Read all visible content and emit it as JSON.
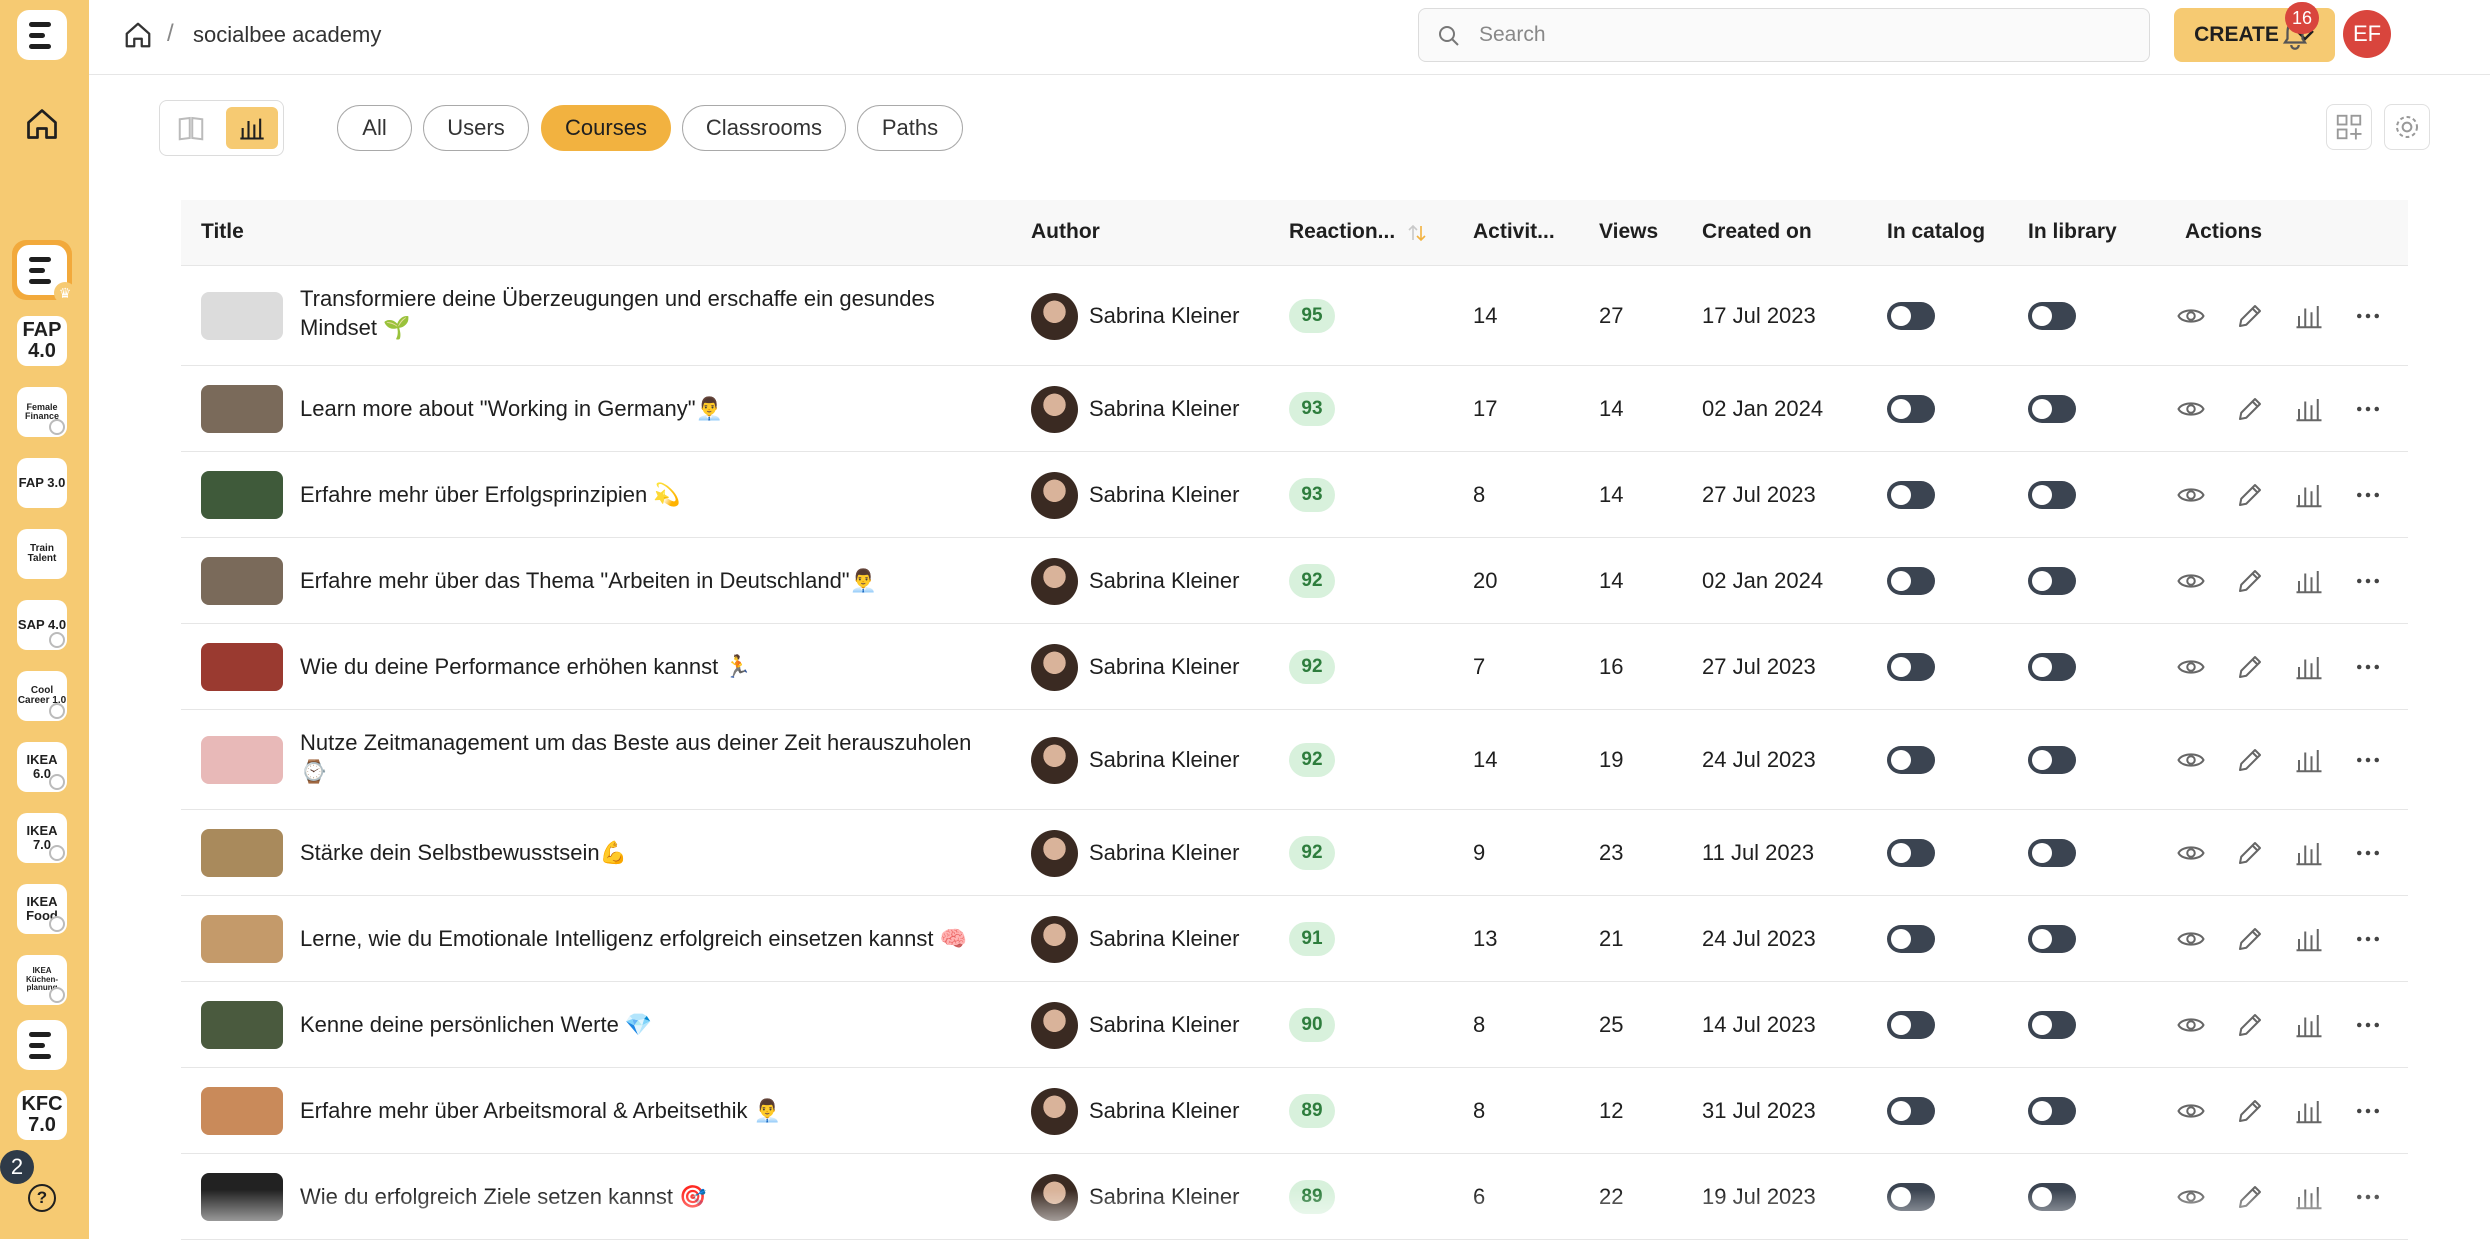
{
  "sidebar": {
    "tiles": [
      {
        "label": "FAP 4.0",
        "lock": false
      },
      {
        "label": "Female Finance",
        "lock": true
      },
      {
        "label": "FAP 3.0",
        "lock": false
      },
      {
        "label": "Train Talent",
        "lock": false
      },
      {
        "label": "SAP 4.0",
        "lock": true
      },
      {
        "label": "Cool Career 1.0",
        "lock": true
      },
      {
        "label": "IKEA 6.0",
        "lock": true
      },
      {
        "label": "IKEA 7.0",
        "lock": true
      },
      {
        "label": "IKEA Food",
        "lock": true
      },
      {
        "label": "IKEA Küchen-planung",
        "lock": true
      },
      {
        "label": "KFC 7.0",
        "lock": false
      }
    ],
    "count": "2",
    "help": "?"
  },
  "topbar": {
    "crumb_sep": "/",
    "breadcrumb": "socialbee academy",
    "search_placeholder": "Search",
    "create_label": "CREATE",
    "notifications": "16",
    "user_initials": "EF"
  },
  "filters": [
    "All",
    "Users",
    "Courses",
    "Classrooms",
    "Paths"
  ],
  "active_filter": "Courses",
  "table": {
    "headers": {
      "title": "Title",
      "author": "Author",
      "reactions": "Reaction...",
      "activity": "Activit...",
      "views": "Views",
      "created": "Created on",
      "catalog": "In catalog",
      "library": "In library",
      "actions": "Actions"
    },
    "rows": [
      {
        "title": "Transformiere deine Überzeugungen und erschaffe ein gesundes Mindset 🌱",
        "author": "Sabrina Kleiner",
        "reactions": "95",
        "activity": "14",
        "views": "27",
        "created": "17 Jul 2023",
        "thumb": "#dcdcdc"
      },
      {
        "title": "Learn more about \"Working in Germany\"👨‍💼",
        "author": "Sabrina Kleiner",
        "reactions": "93",
        "activity": "17",
        "views": "14",
        "created": "02 Jan 2024",
        "thumb": "#7a6a5a"
      },
      {
        "title": "Erfahre mehr über Erfolgsprinzipien 💫",
        "author": "Sabrina Kleiner",
        "reactions": "93",
        "activity": "8",
        "views": "14",
        "created": "27 Jul 2023",
        "thumb": "#3f5a3a"
      },
      {
        "title": "Erfahre mehr über das Thema \"Arbeiten in Deutschland\"👨‍💼",
        "author": "Sabrina Kleiner",
        "reactions": "92",
        "activity": "20",
        "views": "14",
        "created": "02 Jan 2024",
        "thumb": "#7a6a5a"
      },
      {
        "title": "Wie du deine Performance erhöhen kannst 🏃",
        "author": "Sabrina Kleiner",
        "reactions": "92",
        "activity": "7",
        "views": "16",
        "created": "27 Jul 2023",
        "thumb": "#9a3a30"
      },
      {
        "title": "Nutze Zeitmanagement um das Beste aus deiner Zeit herauszuholen ⌚",
        "author": "Sabrina Kleiner",
        "reactions": "92",
        "activity": "14",
        "views": "19",
        "created": "24 Jul 2023",
        "thumb": "#e8b9b8"
      },
      {
        "title": "Stärke dein Selbstbewusstsein💪",
        "author": "Sabrina Kleiner",
        "reactions": "92",
        "activity": "9",
        "views": "23",
        "created": "11 Jul 2023",
        "thumb": "#a98a5c"
      },
      {
        "title": "Lerne, wie du Emotionale Intelligenz erfolgreich einsetzen kannst 🧠",
        "author": "Sabrina Kleiner",
        "reactions": "91",
        "activity": "13",
        "views": "21",
        "created": "24 Jul 2023",
        "thumb": "#c49a6a"
      },
      {
        "title": "Kenne deine persönlichen Werte 💎",
        "author": "Sabrina Kleiner",
        "reactions": "90",
        "activity": "8",
        "views": "25",
        "created": "14 Jul 2023",
        "thumb": "#4a5a3e"
      },
      {
        "title": "Erfahre mehr über Arbeitsmoral & Arbeitsethik 👨‍💼",
        "author": "Sabrina Kleiner",
        "reactions": "89",
        "activity": "8",
        "views": "12",
        "created": "31 Jul 2023",
        "thumb": "#c98a5a"
      },
      {
        "title": "Wie du erfolgreich Ziele setzen kannst 🎯",
        "author": "Sabrina Kleiner",
        "reactions": "89",
        "activity": "6",
        "views": "22",
        "created": "19 Jul 2023",
        "thumb": "#222222"
      }
    ]
  },
  "colors": {
    "accent": "#f6ca72",
    "active": "#f2b240",
    "badge_green": "#d8f1dc",
    "alert": "#d9453d"
  }
}
